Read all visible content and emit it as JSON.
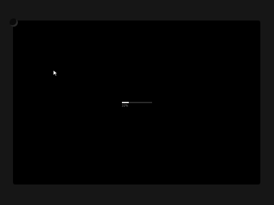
{
  "loader": {
    "progress": 0.22,
    "status_text": "22%"
  },
  "colors": {
    "page_bg": "#161616",
    "window_bg": "#000000",
    "progress_fill": "#d9d9d9",
    "progress_track": "#2b2b2b"
  },
  "icons": {
    "cursor": "arrow-cursor-icon",
    "corner": "corner-badge-icon"
  }
}
